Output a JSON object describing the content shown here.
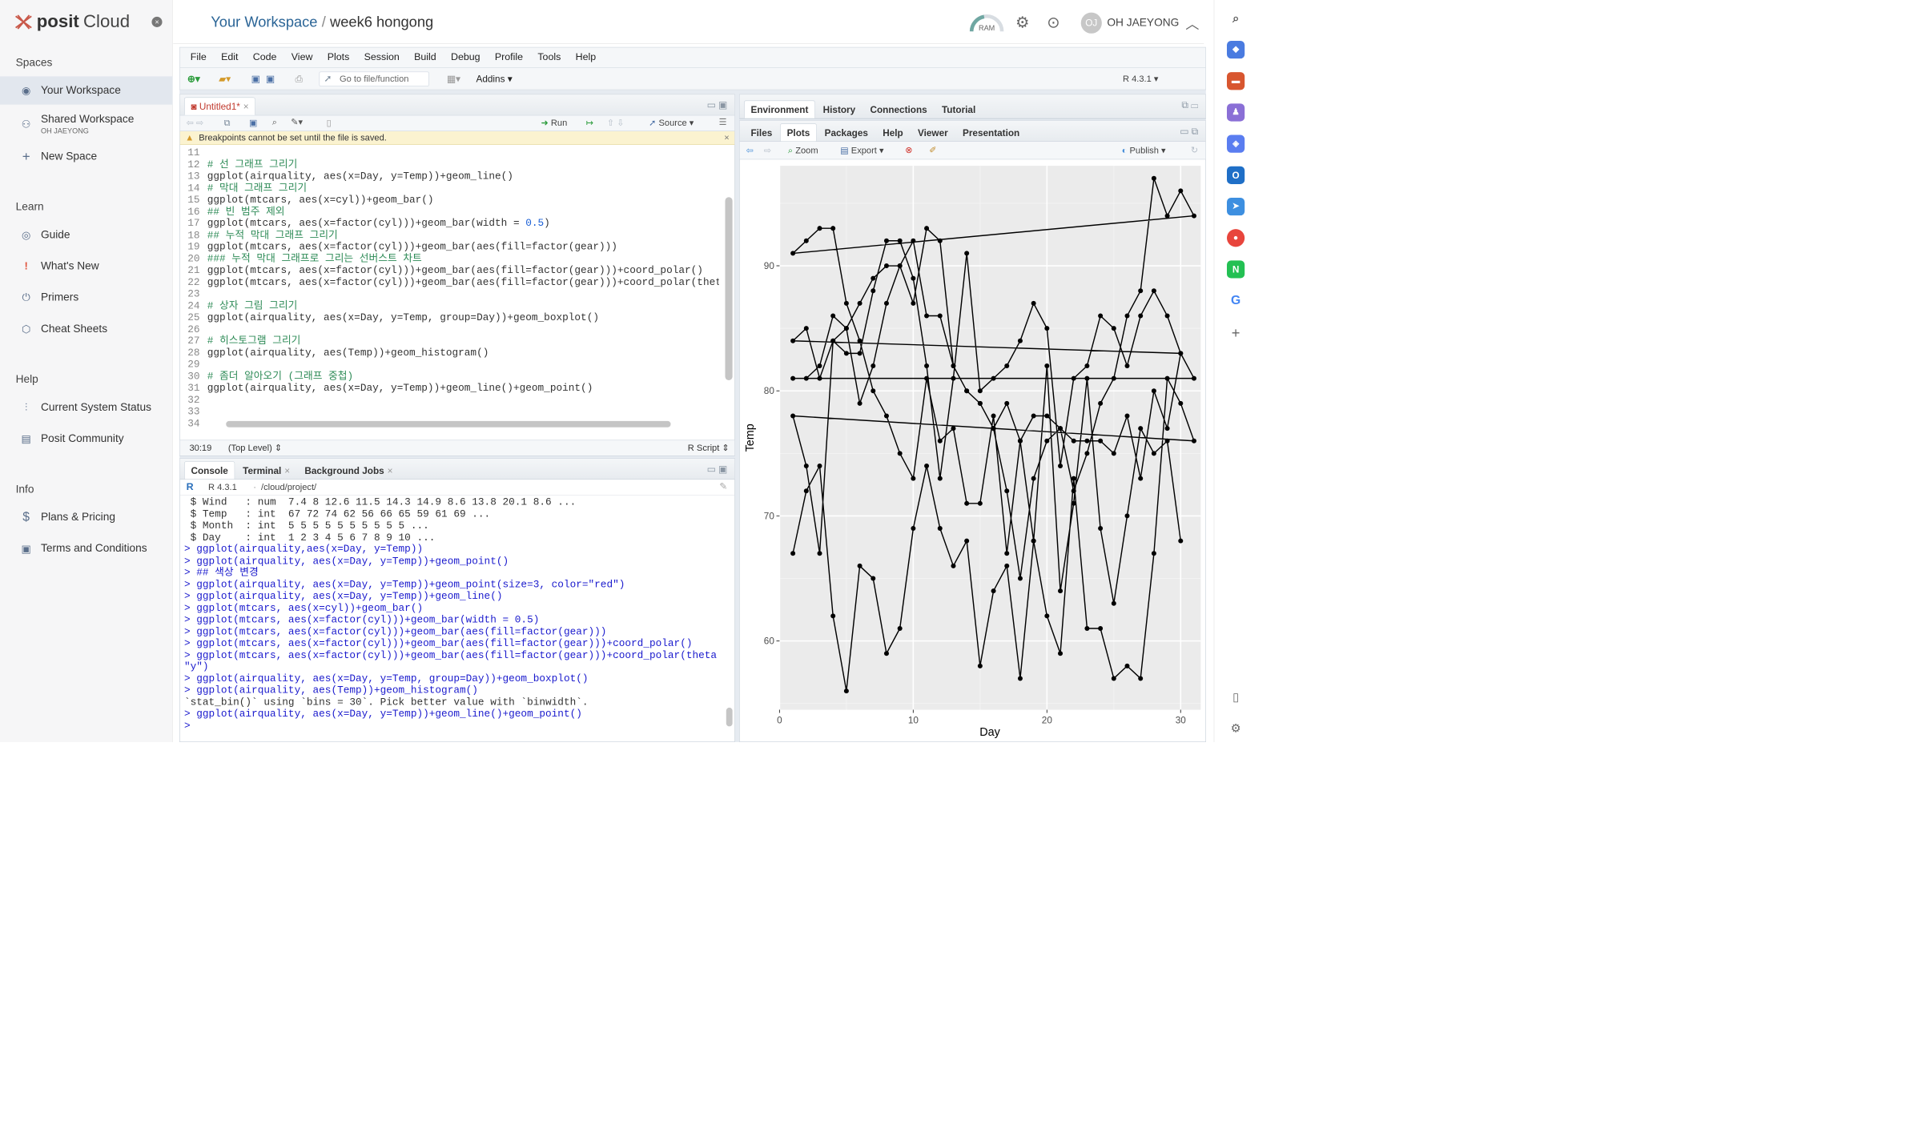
{
  "sidebar": {
    "logo_brand": "posit",
    "logo_product": "Cloud",
    "spaces_heading": "Spaces",
    "your_workspace": "Your Workspace",
    "shared_workspace": "Shared Workspace",
    "shared_owner": "OH JAEYONG",
    "new_space": "New Space",
    "learn_heading": "Learn",
    "learn_items": [
      "Guide",
      "What's New",
      "Primers",
      "Cheat Sheets"
    ],
    "help_heading": "Help",
    "help_items": [
      "Current System Status",
      "Posit Community"
    ],
    "info_heading": "Info",
    "info_items": [
      "Plans & Pricing",
      "Terms and Conditions"
    ]
  },
  "header": {
    "workspace": "Your Workspace",
    "separator": "/",
    "project": "week6 hongong",
    "ram_label": "RAM",
    "user_initials": "OJ",
    "user_name": "OH JAEYONG"
  },
  "menu": [
    "File",
    "Edit",
    "Code",
    "View",
    "Plots",
    "Session",
    "Build",
    "Debug",
    "Profile",
    "Tools",
    "Help"
  ],
  "toolbar": {
    "goto_placeholder": "Go to file/function",
    "addins": "Addins",
    "r_version": "R 4.3.1"
  },
  "editor": {
    "tab": "Untitled1*",
    "run": "Run",
    "source": "Source",
    "warning": "Breakpoints cannot be set until the file is saved.",
    "lines": [
      {
        "n": "11",
        "t": ""
      },
      {
        "n": "12",
        "t": "# 선 그래프 그리기",
        "c": "cm"
      },
      {
        "n": "13",
        "t": "ggplot(airquality, aes(x=Day, y=Temp))+geom_line()"
      },
      {
        "n": "14",
        "t": "# 막대 그래프 그리기",
        "c": "cm"
      },
      {
        "n": "15",
        "t": "ggplot(mtcars, aes(x=cyl))+geom_bar()"
      },
      {
        "n": "16",
        "t": "## 빈 범주 제외",
        "c": "cm"
      },
      {
        "n": "17",
        "t": "ggplot(mtcars, aes(x=factor(cyl)))+geom_bar(width = 0.5)"
      },
      {
        "n": "18",
        "t": "## 누적 막대 그래프 그리기",
        "c": "cm"
      },
      {
        "n": "19",
        "t": "ggplot(mtcars, aes(x=factor(cyl)))+geom_bar(aes(fill=factor(gear)))"
      },
      {
        "n": "20",
        "t": "### 누적 막대 그래프로 그리는 선버스트 차트",
        "c": "cm"
      },
      {
        "n": "21",
        "t": "ggplot(mtcars, aes(x=factor(cyl)))+geom_bar(aes(fill=factor(gear)))+coord_polar()"
      },
      {
        "n": "22",
        "t": "ggplot(mtcars, aes(x=factor(cyl)))+geom_bar(aes(fill=factor(gear)))+coord_polar(thet"
      },
      {
        "n": "23",
        "t": ""
      },
      {
        "n": "24",
        "t": "# 상자 그림 그리기",
        "c": "cm"
      },
      {
        "n": "25",
        "t": "ggplot(airquality, aes(x=Day, y=Temp, group=Day))+geom_boxplot()"
      },
      {
        "n": "26",
        "t": ""
      },
      {
        "n": "27",
        "t": "# 히스토그램 그리기",
        "c": "cm"
      },
      {
        "n": "28",
        "t": "ggplot(airquality, aes(Temp))+geom_histogram()"
      },
      {
        "n": "29",
        "t": ""
      },
      {
        "n": "30",
        "t": "# 좀더 알아오기 (그래프 중첩)",
        "c": "cm"
      },
      {
        "n": "31",
        "t": "ggplot(airquality, aes(x=Day, y=Temp))+geom_line()+geom_point()"
      },
      {
        "n": "32",
        "t": ""
      },
      {
        "n": "33",
        "t": ""
      },
      {
        "n": "34",
        "t": ""
      }
    ],
    "cursor": "30:19",
    "scope": "(Top Level)",
    "filetype": "R Script"
  },
  "console": {
    "tabs": [
      "Console",
      "Terminal",
      "Background Jobs"
    ],
    "r_version": "R 4.3.1",
    "path": "/cloud/project/",
    "lines": [
      {
        "t": " $ Wind   : num  7.4 8 12.6 11.5 14.3 14.9 8.6 13.8 20.1 8.6 ..."
      },
      {
        "t": " $ Temp   : int  67 72 74 62 56 66 65 59 61 69 ..."
      },
      {
        "t": " $ Month  : int  5 5 5 5 5 5 5 5 5 5 ..."
      },
      {
        "t": " $ Day    : int  1 2 3 4 5 6 7 8 9 10 ..."
      },
      {
        "t": "> ggplot(airquality,aes(x=Day, y=Temp))",
        "c": "con-in"
      },
      {
        "t": "> ggplot(airquality, aes(x=Day, y=Temp))+geom_point()",
        "c": "con-in"
      },
      {
        "t": "> ## 색상 변경",
        "c": "con-in"
      },
      {
        "t": "> ggplot(airquality, aes(x=Day, y=Temp))+geom_point(size=3, color=\"red\")",
        "c": "con-in"
      },
      {
        "t": "> ggplot(airquality, aes(x=Day, y=Temp))+geom_line()",
        "c": "con-in"
      },
      {
        "t": "> ggplot(mtcars, aes(x=cyl))+geom_bar()",
        "c": "con-in"
      },
      {
        "t": "> ggplot(mtcars, aes(x=factor(cyl)))+geom_bar(width = 0.5)",
        "c": "con-in"
      },
      {
        "t": "> ggplot(mtcars, aes(x=factor(cyl)))+geom_bar(aes(fill=factor(gear)))",
        "c": "con-in"
      },
      {
        "t": "> ggplot(mtcars, aes(x=factor(cyl)))+geom_bar(aes(fill=factor(gear)))+coord_polar()",
        "c": "con-in"
      },
      {
        "t": "> ggplot(mtcars, aes(x=factor(cyl)))+geom_bar(aes(fill=factor(gear)))+coord_polar(theta =",
        "c": "con-in"
      },
      {
        "t": "\"y\")",
        "c": "con-in"
      },
      {
        "t": "> ggplot(airquality, aes(x=Day, y=Temp, group=Day))+geom_boxplot()",
        "c": "con-in"
      },
      {
        "t": "> ggplot(airquality, aes(Temp))+geom_histogram()",
        "c": "con-in"
      },
      {
        "t": "`stat_bin()` using `bins = 30`. Pick better value with `binwidth`."
      },
      {
        "t": "> ggplot(airquality, aes(x=Day, y=Temp))+geom_line()+geom_point()",
        "c": "con-in"
      },
      {
        "t": "> ",
        "c": "con-in"
      }
    ]
  },
  "env_tabs": [
    "Environment",
    "History",
    "Connections",
    "Tutorial"
  ],
  "files_tabs": [
    "Files",
    "Plots",
    "Packages",
    "Help",
    "Viewer",
    "Presentation"
  ],
  "plot_toolbar": {
    "zoom": "Zoom",
    "export": "Export",
    "publish": "Publish"
  },
  "chart_data": {
    "type": "line",
    "xlabel": "Day",
    "ylabel": "Temp",
    "xlim": [
      0,
      31.5
    ],
    "ylim": [
      54.5,
      98
    ],
    "x_ticks": [
      "0",
      "10",
      "20",
      "30"
    ],
    "y_ticks": [
      "60",
      "70",
      "80",
      "90"
    ],
    "grid": true,
    "background": "#ebebeb",
    "x": [
      1,
      2,
      3,
      4,
      5,
      6,
      7,
      8,
      9,
      10,
      11,
      12,
      13,
      14,
      15,
      16,
      17,
      18,
      19,
      20,
      21,
      22,
      23,
      24,
      25,
      26,
      27,
      28,
      29,
      30,
      31,
      1,
      2,
      3,
      4,
      5,
      6,
      7,
      8,
      9,
      10,
      11,
      12,
      13,
      14,
      15,
      16,
      17,
      18,
      19,
      20,
      21,
      22,
      23,
      24,
      25,
      26,
      27,
      28,
      29,
      30,
      1,
      2,
      3,
      4,
      5,
      6,
      7,
      8,
      9,
      10,
      11,
      12,
      13,
      14,
      15,
      16,
      17,
      18,
      19,
      20,
      21,
      22,
      23,
      24,
      25,
      26,
      27,
      28,
      29,
      30,
      31,
      1,
      2,
      3,
      4,
      5,
      6,
      7,
      8,
      9,
      10,
      11,
      12,
      13,
      14,
      15,
      16,
      17,
      18,
      19,
      20,
      21,
      22,
      23,
      24,
      25,
      26,
      27,
      28,
      29,
      30,
      31,
      1,
      2,
      3,
      4,
      5,
      6,
      7,
      8,
      9,
      10,
      11,
      12,
      13,
      14,
      15,
      16,
      17,
      18,
      19,
      20,
      21,
      22,
      23,
      24,
      25,
      26,
      27,
      28,
      29,
      30
    ],
    "y": [
      67,
      72,
      74,
      62,
      56,
      66,
      65,
      59,
      61,
      69,
      74,
      69,
      66,
      68,
      58,
      64,
      66,
      57,
      68,
      62,
      59,
      73,
      61,
      61,
      57,
      58,
      57,
      67,
      81,
      79,
      76,
      78,
      74,
      67,
      84,
      85,
      79,
      82,
      87,
      90,
      87,
      93,
      92,
      82,
      80,
      79,
      77,
      72,
      65,
      73,
      76,
      77,
      76,
      76,
      76,
      75,
      78,
      73,
      80,
      77,
      83,
      84,
      85,
      81,
      84,
      83,
      83,
      88,
      92,
      92,
      89,
      82,
      73,
      81,
      91,
      80,
      81,
      82,
      84,
      87,
      85,
      74,
      81,
      82,
      86,
      85,
      82,
      86,
      88,
      86,
      83,
      81,
      81,
      81,
      82,
      86,
      85,
      87,
      89,
      90,
      90,
      92,
      86,
      86,
      82,
      80,
      79,
      77,
      79,
      76,
      78,
      78,
      77,
      72,
      75,
      79,
      81,
      86,
      88,
      97,
      94,
      96,
      94,
      91,
      92,
      93,
      93,
      87,
      84,
      80,
      78,
      75,
      73,
      81,
      76,
      77,
      71,
      71,
      78,
      67,
      76,
      68,
      82,
      64,
      71,
      81,
      69,
      63,
      70,
      77,
      75,
      76,
      68
    ]
  }
}
